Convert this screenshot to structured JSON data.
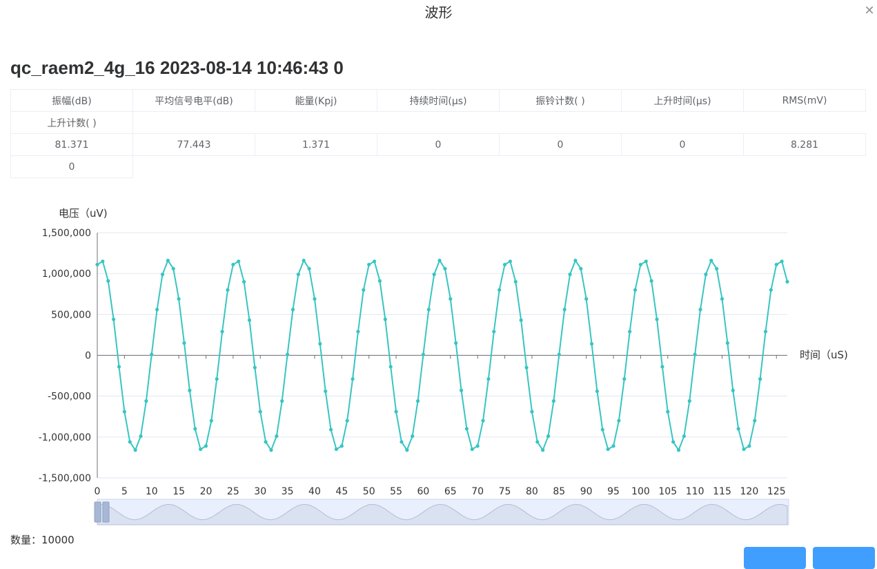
{
  "dialog": {
    "title": "波形",
    "close_icon": "close-icon"
  },
  "event_title": "qc_raem2_4g_16 2023-08-14 10:46:43 0",
  "params_table": {
    "headers": [
      "振幅(dB)",
      "平均信号电平(dB)",
      "能量(Kpj)",
      "持续时间(μs)",
      "振铃计数( )",
      "上升时间(μs)",
      "RMS(mV)",
      "上升计数( )"
    ],
    "values": [
      "81.371",
      "77.443",
      "1.371",
      "0",
      "0",
      "0",
      "8.281",
      "0"
    ]
  },
  "chart_data": {
    "type": "line",
    "ylabel": "电压（uV)",
    "xlabel": "时间（uS)",
    "ylim": [
      -1500000,
      1500000
    ],
    "yticks": [
      "1,500,000",
      "1,000,000",
      "500,000",
      "0",
      "-500,000",
      "-1,000,000",
      "-1,500,000"
    ],
    "xticks": [
      "0",
      "5",
      "10",
      "15",
      "20",
      "25",
      "30",
      "35",
      "40",
      "45",
      "50",
      "55",
      "60",
      "65",
      "70",
      "75",
      "80",
      "85",
      "90",
      "95",
      "100",
      "105",
      "110",
      "115",
      "120",
      "125"
    ],
    "xlim": [
      0,
      127
    ],
    "grid": true,
    "series_color": "#37c5c2",
    "series": [
      {
        "x": [
          0,
          1,
          2,
          3,
          4,
          5,
          6,
          7,
          8,
          9,
          10,
          11,
          12,
          13,
          14,
          15,
          16,
          17,
          18,
          19,
          20,
          21,
          22,
          23,
          24,
          25,
          26,
          27,
          28,
          29,
          30,
          31,
          32,
          33,
          34,
          35,
          36,
          37,
          38,
          39,
          40,
          41,
          42,
          43,
          44,
          45,
          46,
          47,
          48,
          49,
          50,
          51,
          52,
          53,
          54,
          55,
          56,
          57,
          58,
          59,
          60,
          61,
          62,
          63,
          64,
          65,
          66,
          67,
          68,
          69,
          70,
          71,
          72,
          73,
          74,
          75,
          76,
          77,
          78,
          79,
          80,
          81,
          82,
          83,
          84,
          85,
          86,
          87,
          88,
          89,
          90,
          91,
          92,
          93,
          94,
          95,
          96,
          97,
          98,
          99,
          100,
          101,
          102,
          103,
          104,
          105,
          106,
          107,
          108,
          109,
          110,
          111,
          112,
          113,
          114,
          115,
          116,
          117,
          118,
          119,
          120,
          121,
          122,
          123,
          124,
          125,
          126,
          127
        ],
        "values": [
          1110000,
          1150000,
          910000,
          440000,
          -140000,
          -690000,
          -1060000,
          -1160000,
          -990000,
          -560000,
          10000,
          560000,
          990000,
          1160000,
          1060000,
          690000,
          150000,
          -430000,
          -900000,
          -1150000,
          -1110000,
          -800000,
          -290000,
          290000,
          800000,
          1110000,
          1150000,
          900000,
          430000,
          -150000,
          -690000,
          -1060000,
          -1160000,
          -990000,
          -560000,
          10000,
          560000,
          990000,
          1160000,
          1060000,
          690000,
          140000,
          -440000,
          -910000,
          -1150000,
          -1110000,
          -800000,
          -290000,
          290000,
          800000,
          1110000,
          1150000,
          910000,
          440000,
          -140000,
          -690000,
          -1060000,
          -1160000,
          -990000,
          -560000,
          10000,
          560000,
          990000,
          1160000,
          1060000,
          690000,
          150000,
          -430000,
          -900000,
          -1150000,
          -1110000,
          -800000,
          -290000,
          290000,
          800000,
          1110000,
          1150000,
          900000,
          430000,
          -150000,
          -690000,
          -1060000,
          -1160000,
          -990000,
          -560000,
          10000,
          560000,
          990000,
          1160000,
          1060000,
          690000,
          140000,
          -440000,
          -910000,
          -1150000,
          -1110000,
          -800000,
          -290000,
          290000,
          800000,
          1110000,
          1150000,
          910000,
          440000,
          -140000,
          -690000,
          -1060000,
          -1160000,
          -990000,
          -560000,
          10000,
          560000,
          990000,
          1160000,
          1060000,
          690000,
          150000,
          -430000,
          -900000,
          -1150000,
          -1110000,
          -800000,
          -290000,
          290000,
          800000,
          1110000,
          1150000,
          900000
        ]
      }
    ],
    "datazoom": {
      "range": [
        0,
        127
      ],
      "handle_icon": "drag-handle-icon"
    }
  },
  "count": {
    "label": "数量：10000"
  }
}
